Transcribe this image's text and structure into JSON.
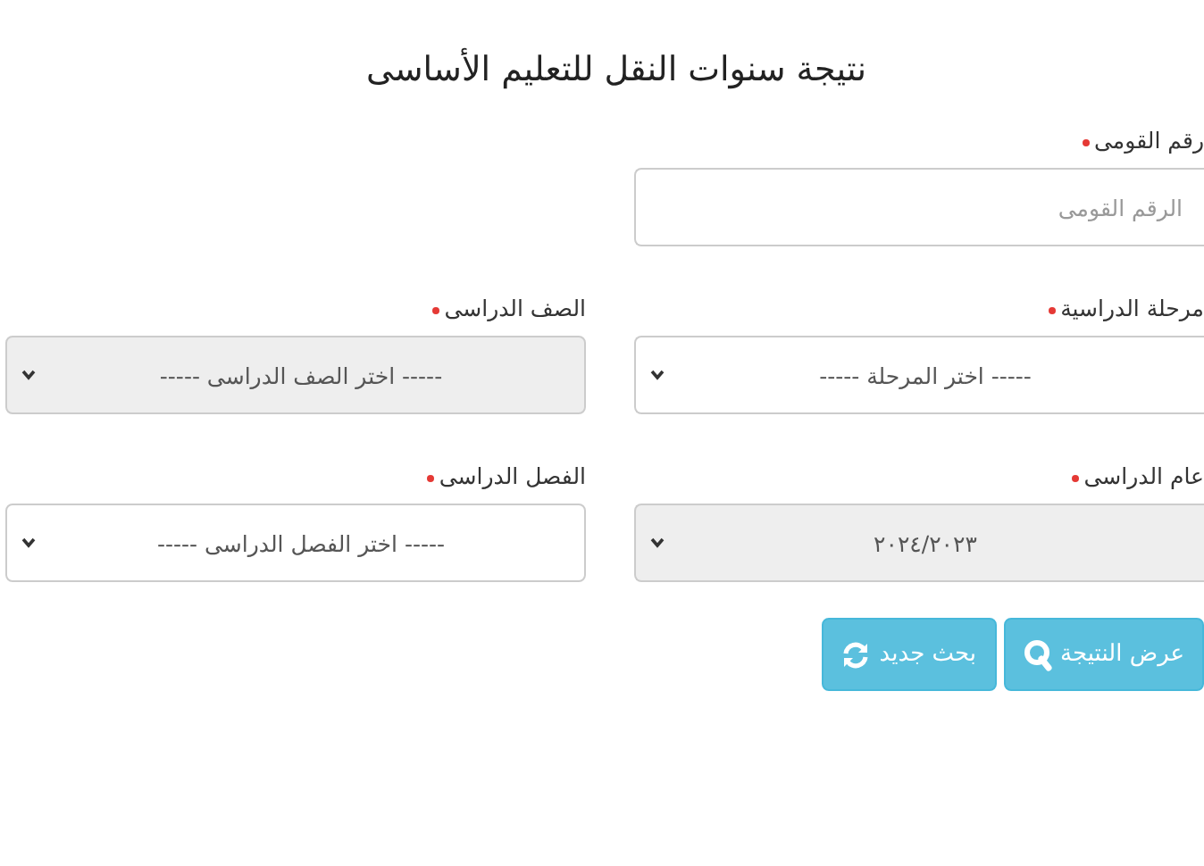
{
  "title": "نتيجة سنوات النقل للتعليم الأساسى",
  "rows": [
    [
      {
        "kind": "text",
        "label": "رقم القومى",
        "required": true,
        "placeholder": "الرقم القومى",
        "disabled": false
      }
    ],
    [
      {
        "kind": "select",
        "label": "مرحلة الدراسية",
        "required": true,
        "placeholder": "----- اختر المرحلة -----",
        "disabled": false
      },
      {
        "kind": "select",
        "label": "الصف الدراسى",
        "required": true,
        "placeholder": "----- اختر الصف الدراسى -----",
        "disabled": true
      }
    ],
    [
      {
        "kind": "select",
        "label": "عام الدراسى",
        "required": true,
        "value": "٢٠٢٤/٢٠٢٣",
        "disabled": true
      },
      {
        "kind": "select",
        "label": "الفصل الدراسى",
        "required": true,
        "placeholder": "----- اختر الفصل الدراسى -----",
        "disabled": false
      }
    ]
  ],
  "buttons": [
    {
      "kind": "search",
      "label": "عرض النتيجة"
    },
    {
      "kind": "refresh",
      "label": "بحث جديد"
    }
  ]
}
